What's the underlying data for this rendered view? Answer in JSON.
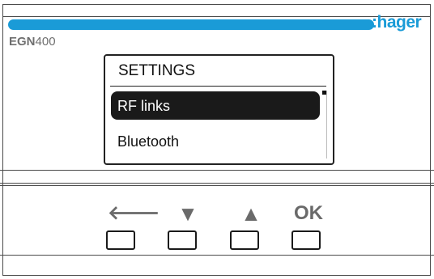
{
  "brand": {
    "logo_text": ":hager",
    "accent_color": "#1a9bd7"
  },
  "device": {
    "model_prefix": "EGN",
    "model_number": "400"
  },
  "screen": {
    "title": "SETTINGS",
    "menu_items": [
      {
        "label": "RF links",
        "selected": true
      },
      {
        "label": "Bluetooth",
        "selected": false
      }
    ]
  },
  "keypad": {
    "keys": [
      {
        "glyph": "🡐",
        "icon": "back-arrow-icon"
      },
      {
        "glyph": "▼",
        "icon": "down-arrow-icon"
      },
      {
        "glyph": "▲",
        "icon": "up-arrow-icon"
      },
      {
        "glyph": "OK",
        "icon": "ok-label"
      }
    ]
  }
}
